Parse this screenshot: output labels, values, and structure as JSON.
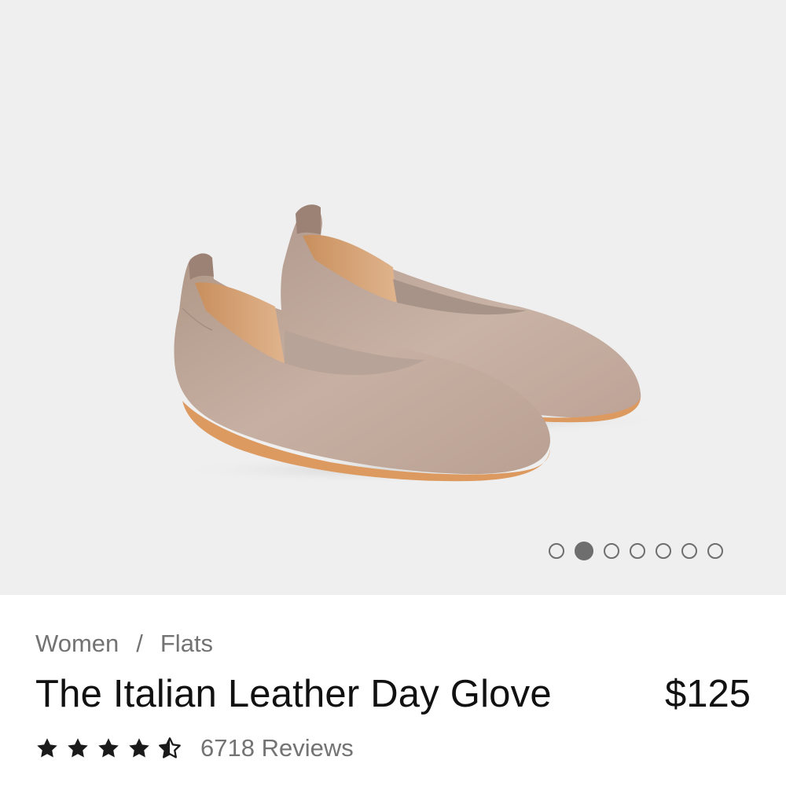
{
  "gallery": {
    "image_alt": "Taupe leather ballet flats",
    "slide_count": 7,
    "active_slide": 2
  },
  "breadcrumb": {
    "items": [
      "Women",
      "Flats"
    ],
    "separator": "/"
  },
  "product": {
    "title": "The Italian Leather Day Glove",
    "price": "$125"
  },
  "rating": {
    "value": 4.5,
    "max": 5,
    "reviews_label": "6718 Reviews"
  },
  "colors": {
    "hero_bg": "#efefef",
    "leather": "#c2aa9d",
    "sole": "#dd9a60",
    "star": "#1a1a1a"
  }
}
